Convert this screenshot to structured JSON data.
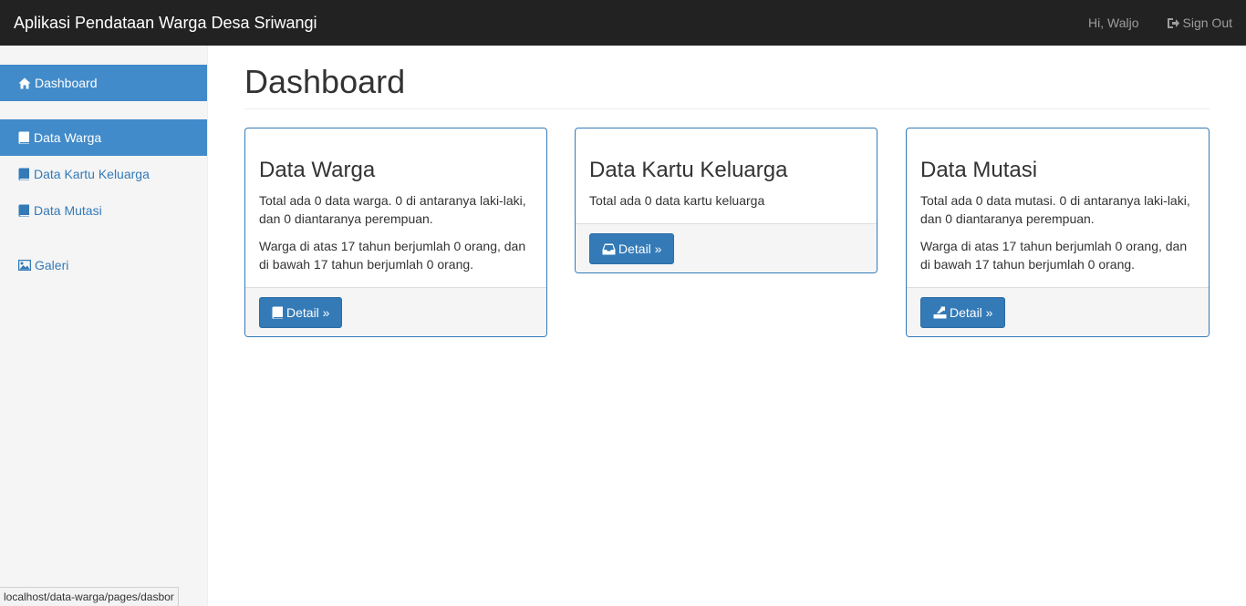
{
  "navbar": {
    "brand": "Aplikasi Pendataan Warga Desa Sriwangi",
    "user_greeting": "Hi, Waljo",
    "signout_label": "Sign Out"
  },
  "sidebar": {
    "items": [
      {
        "label": "Dashboard",
        "icon": "home-icon",
        "active": true
      },
      {
        "label": "Data Warga",
        "icon": "book-icon",
        "active": true
      },
      {
        "label": "Data Kartu Keluarga",
        "icon": "book-icon",
        "active": false
      },
      {
        "label": "Data Mutasi",
        "icon": "book-icon",
        "active": false
      },
      {
        "label": "Galeri",
        "icon": "picture-icon",
        "active": false
      }
    ]
  },
  "main": {
    "title": "Dashboard",
    "panels": [
      {
        "title": "Data Warga",
        "text1": "Total ada 0 data warga. 0 di antaranya laki-laki, dan 0 diantaranya perempuan.",
        "text2": "Warga di atas 17 tahun berjumlah 0 orang, dan di bawah 17 tahun berjumlah 0 orang.",
        "button_label": "Detail »",
        "button_icon": "book-icon"
      },
      {
        "title": "Data Kartu Keluarga",
        "text1": "Total ada 0 data kartu keluarga",
        "button_label": "Detail »",
        "button_icon": "inbox-icon"
      },
      {
        "title": "Data Mutasi",
        "text1": "Total ada 0 data mutasi. 0 di antaranya laki-laki, dan 0 diantaranya perempuan.",
        "text2": "Warga di atas 17 tahun berjumlah 0 orang, dan di bawah 17 tahun berjumlah 0 orang.",
        "button_label": "Detail »",
        "button_icon": "export-icon"
      }
    ]
  },
  "statusbar": {
    "url": "localhost/data-warga/pages/dasbor"
  },
  "colors": {
    "navbar_bg": "#222222",
    "accent": "#337ab7",
    "sidebar_active": "#428bca",
    "sidebar_bg": "#f5f5f5"
  }
}
